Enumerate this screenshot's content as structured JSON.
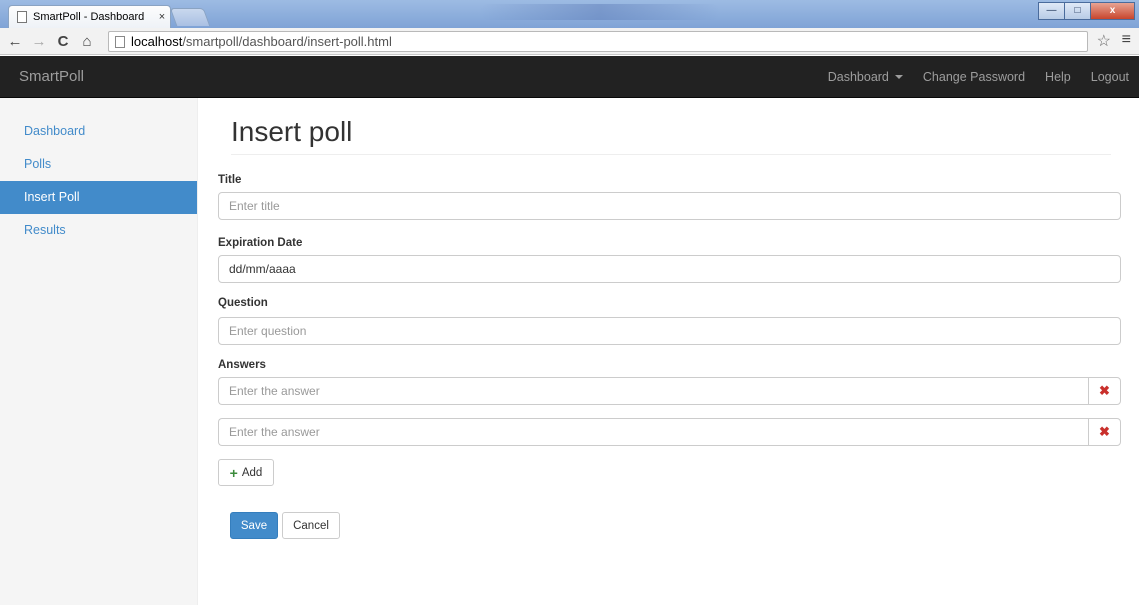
{
  "browser": {
    "tab_title": "SmartPoll - Dashboard",
    "tab_close": "×",
    "url_host": "localhost",
    "url_path": "/smartpoll/dashboard/insert-poll.html",
    "window_controls": {
      "minimize": "—",
      "maximize": "□",
      "close": "x"
    }
  },
  "navbar": {
    "brand": "SmartPoll",
    "links": {
      "dashboard": "Dashboard",
      "change_password": "Change Password",
      "help": "Help",
      "logout": "Logout"
    }
  },
  "sidebar": {
    "items": [
      {
        "label": "Dashboard",
        "active": false
      },
      {
        "label": "Polls",
        "active": false
      },
      {
        "label": "Insert Poll",
        "active": true
      },
      {
        "label": "Results",
        "active": false
      }
    ]
  },
  "main": {
    "page_title": "Insert poll",
    "title_label": "Title",
    "title_placeholder": "Enter title",
    "expiration_label": "Expiration Date",
    "expiration_value": "dd/mm/aaaa",
    "question_label": "Question",
    "question_placeholder": "Enter question",
    "answers_label": "Answers",
    "answers": [
      {
        "placeholder": "Enter the answer"
      },
      {
        "placeholder": "Enter the answer"
      }
    ],
    "remove_icon": "✖",
    "add_label": "Add",
    "save_label": "Save",
    "cancel_label": "Cancel"
  },
  "colors": {
    "navbar_bg": "#222222",
    "link": "#428bca",
    "primary": "#428bca",
    "remove": "#c9302c",
    "add_icon": "#3c8b3c"
  }
}
